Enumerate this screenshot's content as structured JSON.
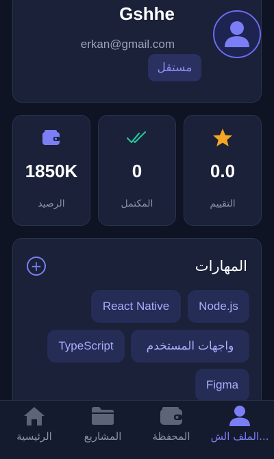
{
  "profile": {
    "name": "Gshhe",
    "email": "erkan@gmail.com",
    "role_badge": "مستقل",
    "avatar_icon": "user-icon"
  },
  "stats": [
    {
      "icon": "wallet-icon",
      "icon_color": "#7b7ef5",
      "value": "1850K",
      "label": "الرصيد"
    },
    {
      "icon": "double-check-icon",
      "icon_color": "#22c59a",
      "value": "0",
      "label": "المكتمل"
    },
    {
      "icon": "star-icon",
      "icon_color": "#f5a623",
      "value": "0.0",
      "label": "التقييم"
    }
  ],
  "skills": {
    "title": "المهارات",
    "add_icon": "plus-circle-icon",
    "items": [
      "Node.js",
      "React Native",
      "واجهات المستخدم",
      "TypeScript",
      "Figma"
    ]
  },
  "nav": {
    "items": [
      {
        "icon": "home-icon",
        "label": "الرئيسية",
        "active": false
      },
      {
        "icon": "folder-icon",
        "label": "المشاريع",
        "active": false
      },
      {
        "icon": "wallet-icon",
        "label": "المحفظة",
        "active": false
      },
      {
        "icon": "user-icon",
        "label": "الملف الش...",
        "active": true
      }
    ]
  },
  "colors": {
    "background": "#0f1424",
    "card": "#1a2138",
    "accent": "#7b7ef5",
    "success": "#22c59a",
    "star": "#f5a623"
  }
}
